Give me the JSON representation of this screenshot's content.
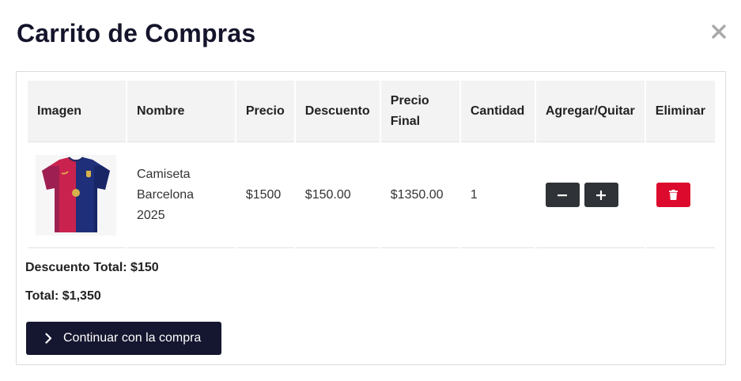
{
  "modal": {
    "title": "Carrito de Compras",
    "close_icon": "close-icon"
  },
  "table": {
    "headers": {
      "image": "Imagen",
      "name": "Nombre",
      "price": "Precio",
      "discount": "Descuento",
      "final_price": "Precio Final",
      "quantity": "Cantidad",
      "add_remove": "Agregar/Quitar",
      "delete": "Eliminar"
    },
    "rows": [
      {
        "image_icon": "barcelona-jersey-image",
        "name": "Camiseta Barcelona 2025",
        "price": "$1500",
        "discount": "$150.00",
        "final_price": "$1350.00",
        "quantity": "1",
        "decrement_icon": "minus-icon",
        "increment_icon": "plus-icon",
        "delete_icon": "trash-icon"
      }
    ]
  },
  "summary": {
    "discount_total": "Descuento Total: $150",
    "total": "Total: $1,350"
  },
  "actions": {
    "continue_label": "Continuar con la compra",
    "continue_icon": "chevron-right-icon"
  },
  "colors": {
    "title": "#14142b",
    "header_bg": "#f3f3f3",
    "qty_button": "#2f3337",
    "delete_button": "#dc0b2e",
    "continue_button": "#15162f"
  }
}
